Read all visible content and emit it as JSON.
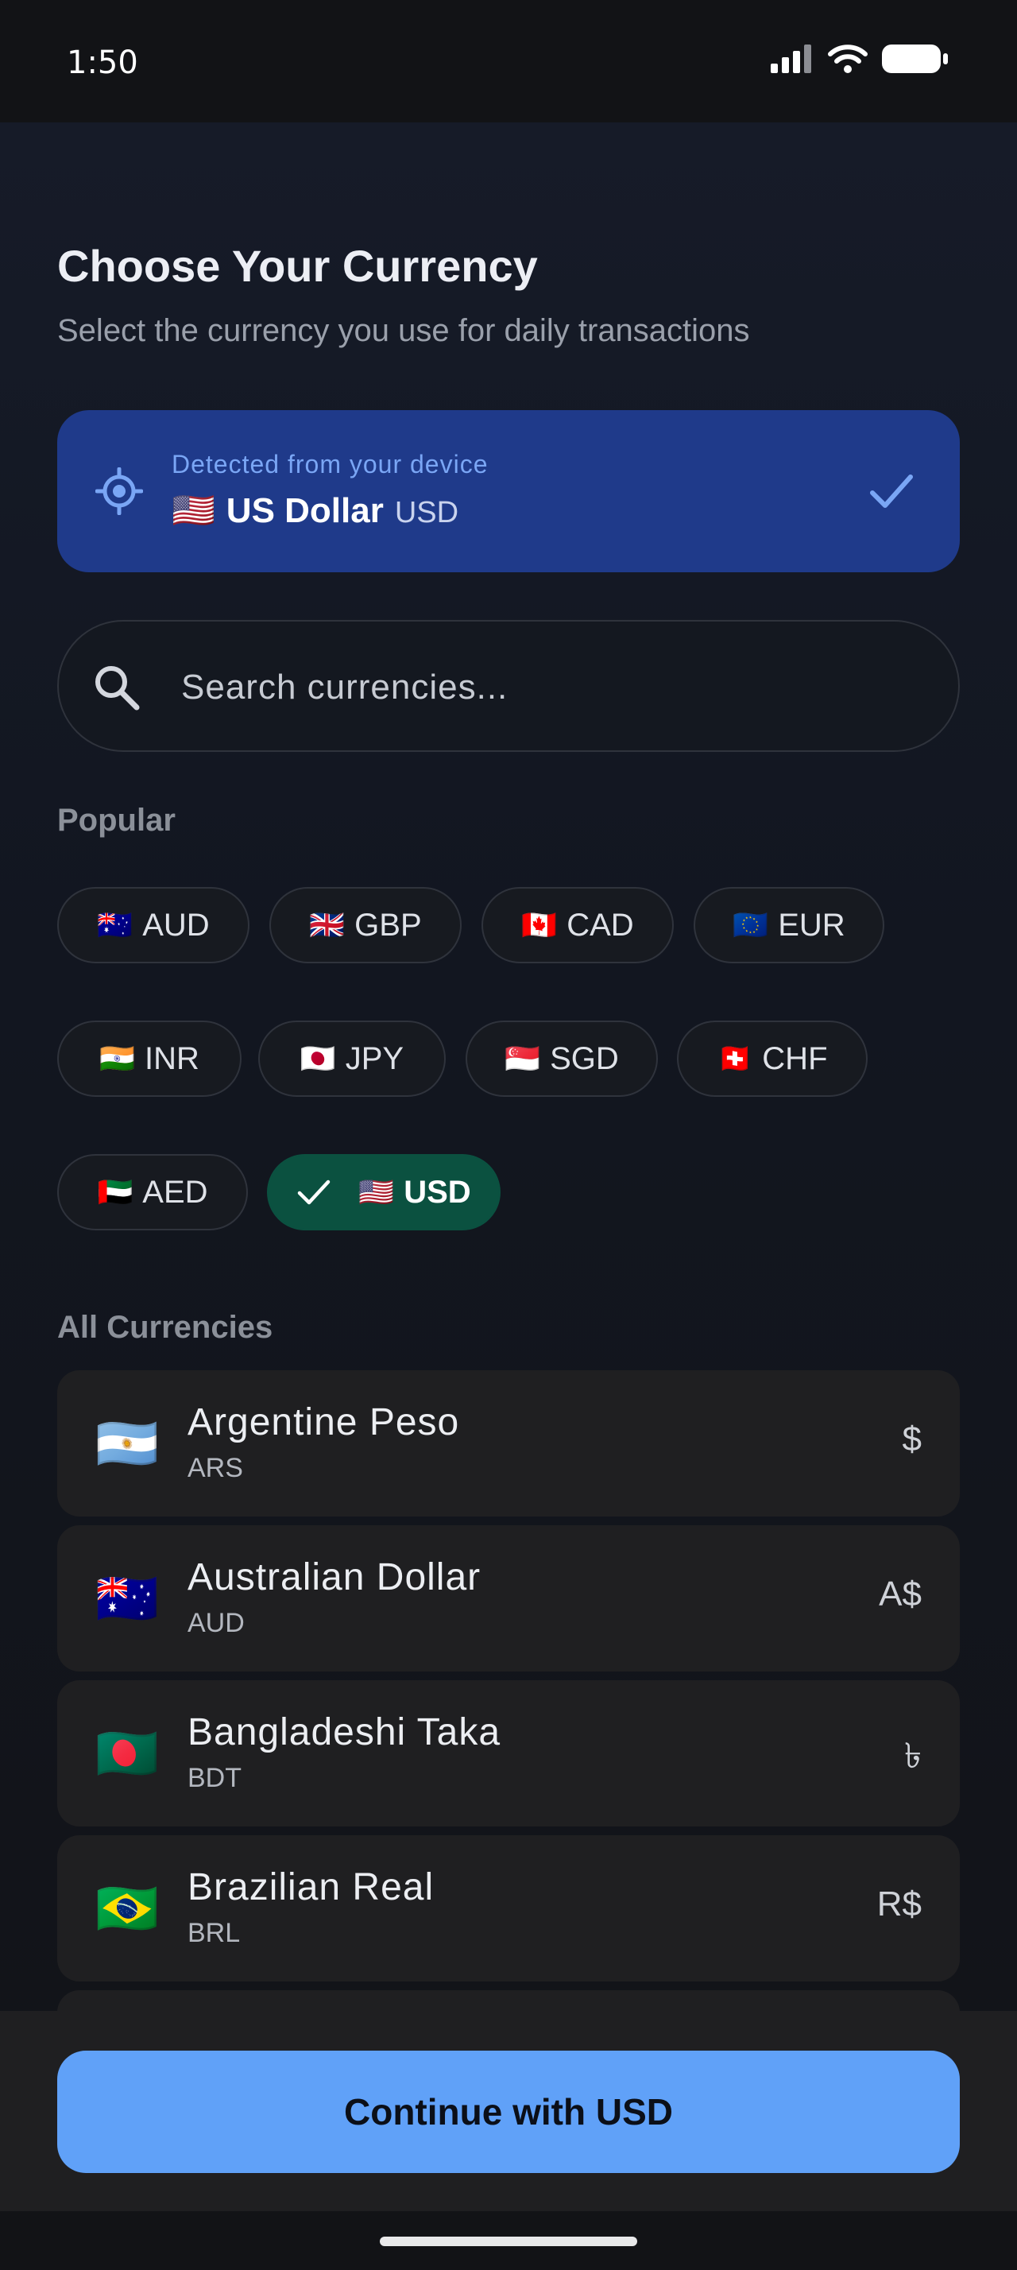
{
  "status_bar": {
    "time": "1:50"
  },
  "header": {
    "title": "Choose Your Currency",
    "subtitle": "Select the currency you use for daily transactions"
  },
  "detected": {
    "caption": "Detected from your device",
    "flag": "🇺🇸",
    "name": "US Dollar",
    "code": "USD"
  },
  "search": {
    "placeholder": "Search currencies..."
  },
  "popular": {
    "label": "Popular",
    "chips": [
      {
        "flag": "🇦🇺",
        "code": "AUD"
      },
      {
        "flag": "🇬🇧",
        "code": "GBP"
      },
      {
        "flag": "🇨🇦",
        "code": "CAD"
      },
      {
        "flag": "🇪🇺",
        "code": "EUR"
      },
      {
        "flag": "🇮🇳",
        "code": "INR"
      },
      {
        "flag": "🇯🇵",
        "code": "JPY"
      },
      {
        "flag": "🇸🇬",
        "code": "SGD"
      },
      {
        "flag": "🇨🇭",
        "code": "CHF"
      },
      {
        "flag": "🇦🇪",
        "code": "AED"
      },
      {
        "flag": "🇺🇸",
        "code": "USD",
        "selected": true
      }
    ]
  },
  "all_currencies": {
    "label": "All Currencies",
    "items": [
      {
        "flag": "🇦🇷",
        "name": "Argentine Peso",
        "code": "ARS",
        "symbol": "$"
      },
      {
        "flag": "🇦🇺",
        "name": "Australian Dollar",
        "code": "AUD",
        "symbol": "A$"
      },
      {
        "flag": "🇧🇩",
        "name": "Bangladeshi Taka",
        "code": "BDT",
        "symbol": "৳"
      },
      {
        "flag": "🇧🇷",
        "name": "Brazilian Real",
        "code": "BRL",
        "symbol": "R$"
      }
    ]
  },
  "footer": {
    "continue_label": "Continue with USD"
  },
  "colors": {
    "accent": "#60a1f8",
    "detected_bg": "#1f3a8a",
    "selected_chip": "#0b5140",
    "row_bg": "#1f1f21"
  }
}
